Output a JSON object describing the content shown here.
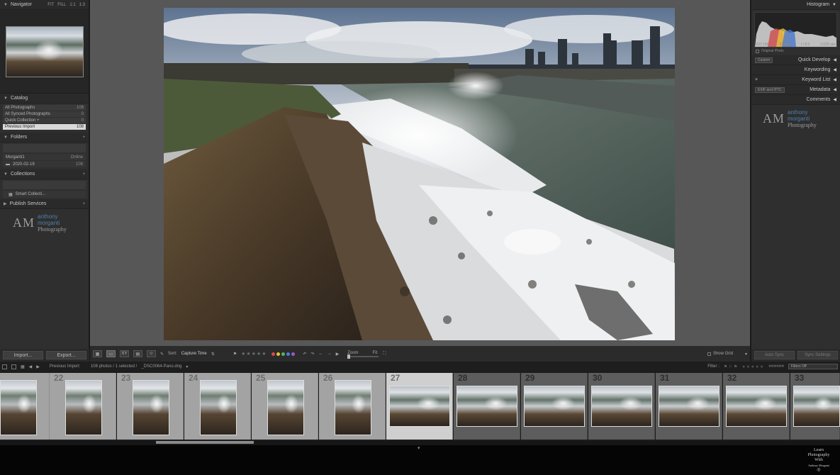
{
  "left_panel": {
    "navigator": {
      "title": "Navigator",
      "zoom_options": [
        "FIT",
        "FILL",
        "1:1",
        "1:3"
      ]
    },
    "catalog": {
      "title": "Catalog",
      "items": [
        {
          "label": "All Photographs",
          "count": "108"
        },
        {
          "label": "All Synced Photographs",
          "count": "0"
        },
        {
          "label": "Quick Collection +",
          "count": "0"
        },
        {
          "label": "Previous Import",
          "count": "108"
        }
      ]
    },
    "folders": {
      "title": "Folders",
      "volume": {
        "label": "Morganti1",
        "info": "Online"
      },
      "folder": {
        "label": "2020-02-19",
        "count": "108"
      }
    },
    "collections": {
      "title": "Collections",
      "item": "Smart Collecti..."
    },
    "publish": {
      "title": "Publish Services"
    },
    "watermark": {
      "initials": "AM",
      "name": "anthony morganti",
      "sub": "Photography"
    },
    "import_label": "Import...",
    "export_label": "Export..."
  },
  "toolbar": {
    "sort_label": "Sort:",
    "sort_value": "Capture Time",
    "zoom_label": "Zoom",
    "zoom_value": "Fit",
    "show_grid": "Show Grid",
    "stars": "★★★★★",
    "label_colors": [
      "#d94b4b",
      "#e3c33b",
      "#5ab35a",
      "#4a7cd9",
      "#9a59c9"
    ]
  },
  "right_panel": {
    "histogram_title": "Histogram",
    "histo_info": [
      "ISO 100",
      "24 mm",
      "f / 8.0",
      "1/125 sec"
    ],
    "original_photo": "Original Photo",
    "quick_develop": "Quick Develop",
    "custom_label": "Custom",
    "keywording": "Keywording",
    "keyword_list": "Keyword List",
    "metadata": "Metadata",
    "exif_label": "EXIF and IPTC",
    "comments": "Comments",
    "watermark": {
      "initials": "AM",
      "name": "anthony morganti",
      "sub": "Photography"
    },
    "auto_sync": "Auto Sync",
    "sync_settings": "Sync Settings"
  },
  "filmstrip_bar": {
    "source": "Previous Import",
    "info": "108 photos / 1 selected /",
    "filename": "_DSC0064-Pano.dng",
    "filter_label": "Filter :",
    "filters_off": "Filters Off"
  },
  "filmstrip": {
    "cells": [
      {
        "num": "",
        "orient": "portrait",
        "dark": false,
        "selected": false
      },
      {
        "num": "22",
        "orient": "portrait",
        "dark": false,
        "selected": false
      },
      {
        "num": "23",
        "orient": "portrait",
        "dark": false,
        "selected": false
      },
      {
        "num": "24",
        "orient": "portrait",
        "dark": false,
        "selected": false
      },
      {
        "num": "25",
        "orient": "portrait",
        "dark": false,
        "selected": false
      },
      {
        "num": "26",
        "orient": "portrait",
        "dark": false,
        "selected": false
      },
      {
        "num": "27",
        "orient": "land",
        "dark": false,
        "selected": true
      },
      {
        "num": "28",
        "orient": "land",
        "dark": true,
        "selected": false
      },
      {
        "num": "29",
        "orient": "land",
        "dark": true,
        "selected": false
      },
      {
        "num": "30",
        "orient": "land",
        "dark": true,
        "selected": false
      },
      {
        "num": "31",
        "orient": "land",
        "dark": true,
        "selected": false
      },
      {
        "num": "32",
        "orient": "land",
        "dark": true,
        "selected": false
      },
      {
        "num": "33",
        "orient": "land",
        "dark": true,
        "selected": false
      }
    ]
  },
  "corner_logo": [
    "Learn",
    "Photography",
    "With",
    "Anthony Morganti"
  ]
}
